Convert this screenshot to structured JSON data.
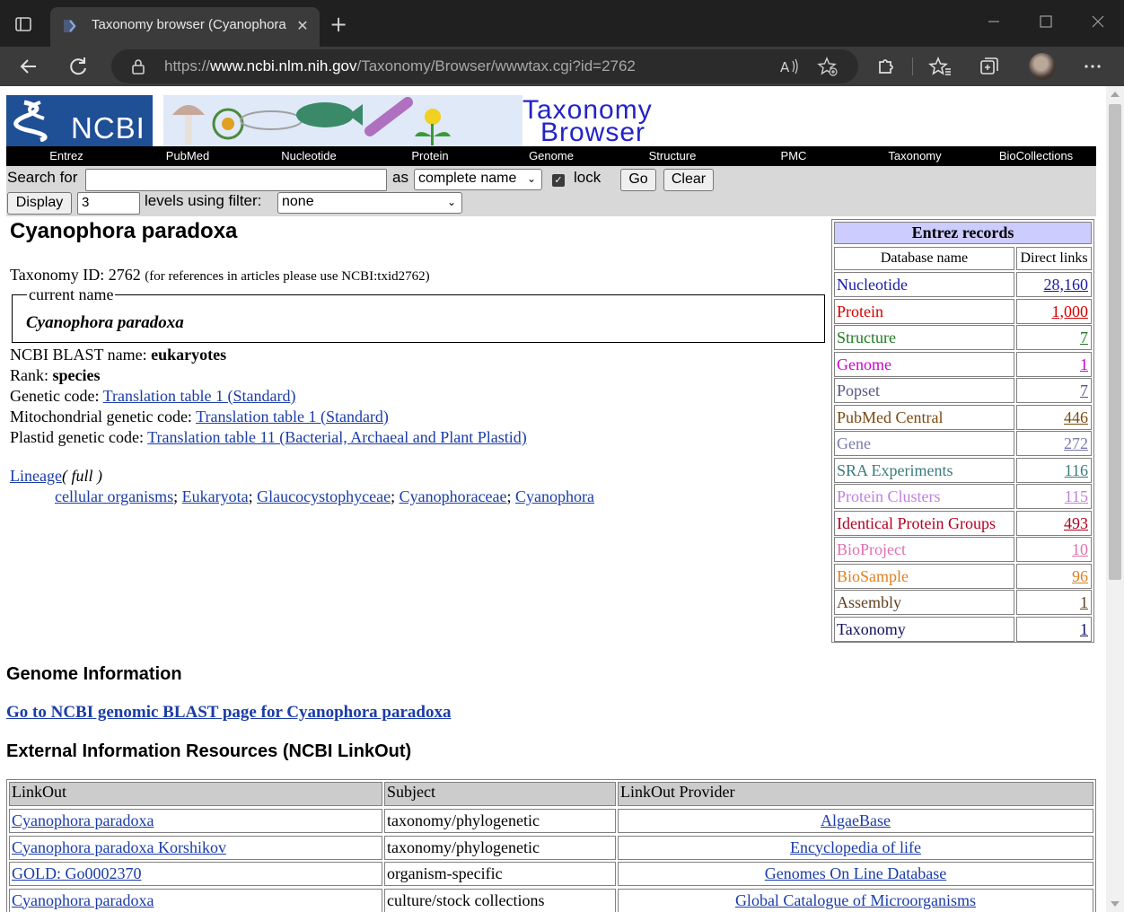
{
  "browser": {
    "tab_title": "Taxonomy browser (Cyanophora",
    "url_prefix": "https://",
    "url_host": "www.ncbi.nlm.nih.gov",
    "url_path": "/Taxonomy/Browser/wwwtax.cgi?id=2762"
  },
  "header": {
    "logo_text": "NCBI",
    "banner_line1": "Taxonomy",
    "banner_line2": "Browser"
  },
  "nav": [
    "Entrez",
    "PubMed",
    "Nucleotide",
    "Protein",
    "Genome",
    "Structure",
    "PMC",
    "Taxonomy",
    "BioCollections"
  ],
  "search": {
    "search_for_label": "Search for",
    "search_value": "",
    "as_label": "as",
    "as_selected": "complete name",
    "lock_label": "lock",
    "go_label": "Go",
    "clear_label": "Clear",
    "display_label": "Display",
    "levels_value": "3",
    "levels_label": "levels using filter:",
    "filter_selected": "none"
  },
  "organism": {
    "title": "Cyanophora paradoxa",
    "taxonomy_id_label": "Taxonomy ID: 2762",
    "taxonomy_id_note": "(for references in articles please use NCBI:txid2762)",
    "current_name_legend": "current name",
    "current_name": "Cyanophora paradoxa",
    "blast_name_label": "NCBI BLAST name:",
    "blast_name": "eukaryotes",
    "rank_label": "Rank:",
    "rank": "species",
    "genetic_code_label": "Genetic code:",
    "genetic_code": "Translation table 1 (Standard)",
    "mito_code_label": "Mitochondrial genetic code:",
    "mito_code": "Translation table 1 (Standard)",
    "plastid_code_label": "Plastid genetic code:",
    "plastid_code": "Translation table 11 (Bacterial, Archaeal and Plant Plastid)",
    "lineage_label": "Lineage",
    "lineage_full": "( full )",
    "lineage": [
      "cellular organisms",
      "Eukaryota",
      "Glaucocystophyceae",
      "Cyanophoraceae",
      "Cyanophora"
    ]
  },
  "entrez": {
    "title": "Entrez records",
    "col_db": "Database name",
    "col_links": "Direct links",
    "rows": [
      {
        "name": "Nucleotide",
        "count": "28,160",
        "color": "#1a1aa6"
      },
      {
        "name": "Protein",
        "count": "1,000",
        "color": "#d40000"
      },
      {
        "name": "Structure",
        "count": "7",
        "color": "#1f7a1f"
      },
      {
        "name": "Genome",
        "count": "1",
        "color": "#cc00cc"
      },
      {
        "name": "Popset",
        "count": "7",
        "color": "#555588"
      },
      {
        "name": "PubMed Central",
        "count": "446",
        "color": "#7a4a10"
      },
      {
        "name": "Gene",
        "count": "272",
        "color": "#7a7ab0"
      },
      {
        "name": "SRA Experiments",
        "count": "116",
        "color": "#3a7a7a"
      },
      {
        "name": "Protein Clusters",
        "count": "115",
        "color": "#c080e0"
      },
      {
        "name": "Identical Protein Groups",
        "count": "493",
        "color": "#b00020"
      },
      {
        "name": "BioProject",
        "count": "10",
        "color": "#e070b0"
      },
      {
        "name": "BioSample",
        "count": "96",
        "color": "#e08020"
      },
      {
        "name": "Assembly",
        "count": "1",
        "color": "#604020"
      },
      {
        "name": "Taxonomy",
        "count": "1",
        "color": "#101060"
      }
    ]
  },
  "genome_info": {
    "heading": "Genome Information",
    "blast_link": "Go to NCBI genomic BLAST page for Cyanophora paradoxa"
  },
  "linkout": {
    "heading": "External Information Resources (NCBI LinkOut)",
    "headers": [
      "LinkOut",
      "Subject",
      "LinkOut Provider"
    ],
    "rows": [
      [
        "Cyanophora paradoxa",
        "taxonomy/phylogenetic",
        "AlgaeBase"
      ],
      [
        "Cyanophora paradoxa Korshikov",
        "taxonomy/phylogenetic",
        "Encyclopedia of life"
      ],
      [
        "GOLD: Go0002370",
        "organism-specific",
        "Genomes On Line Database"
      ],
      [
        "Cyanophora paradoxa",
        "culture/stock collections",
        "Global Catalogue of Microorganisms"
      ]
    ]
  }
}
